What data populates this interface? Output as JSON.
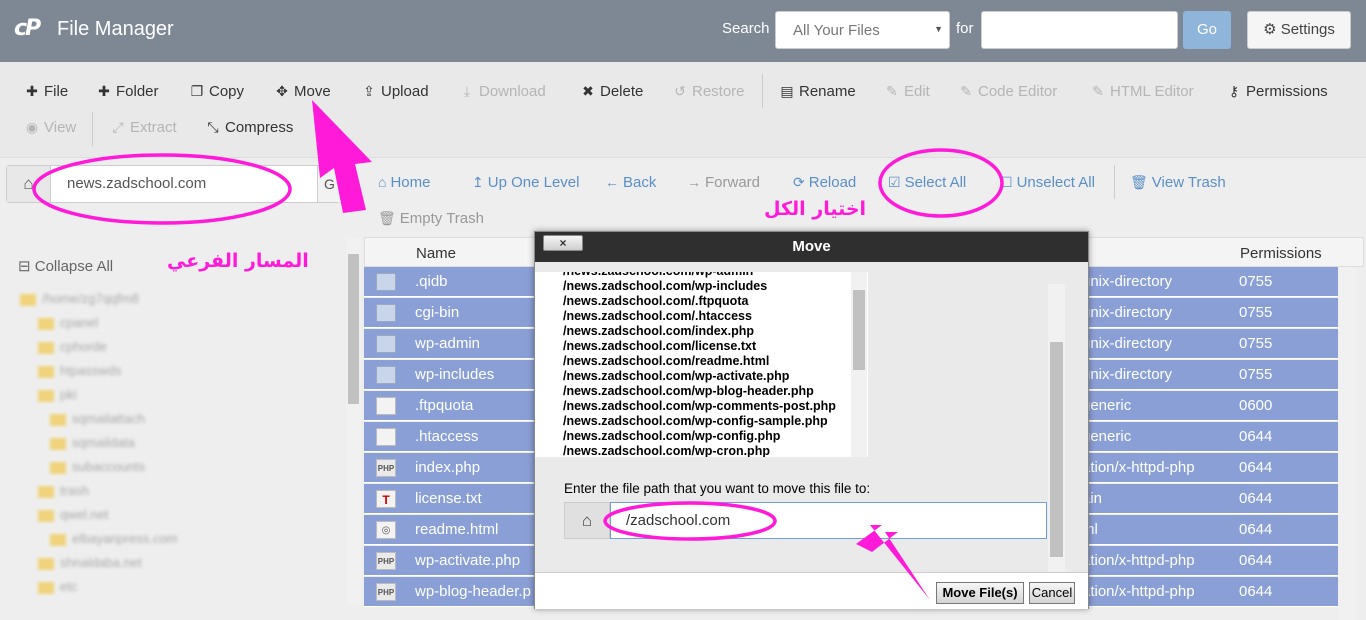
{
  "header": {
    "logo": "cP",
    "title": "File Manager",
    "search_label": "Search",
    "search_scope": "All Your Files",
    "for_label": "for",
    "search_value": "",
    "go_label": "Go",
    "settings_label": "Settings"
  },
  "toolbar": {
    "file": "File",
    "folder": "Folder",
    "copy": "Copy",
    "move": "Move",
    "upload": "Upload",
    "download": "Download",
    "delete": "Delete",
    "restore": "Restore",
    "rename": "Rename",
    "edit": "Edit",
    "code_editor": "Code Editor",
    "html_editor": "HTML Editor",
    "permissions": "Permissions",
    "view": "View",
    "extract": "Extract",
    "compress": "Compress"
  },
  "path": {
    "value": "news.zadschool.com",
    "go": "G"
  },
  "nav": {
    "home": "Home",
    "up": "Up One Level",
    "back": "Back",
    "forward": "Forward",
    "reload": "Reload",
    "select_all": "Select All",
    "unselect_all": "Unselect All",
    "view_trash": "View Trash",
    "empty_trash": "Empty Trash"
  },
  "sidebar": {
    "collapse": "Collapse All",
    "tree": [
      "/home/zg7qqfm8",
      "cpanel",
      "cphorde",
      "htpasswds",
      "pki",
      "sqmailattach",
      "sqmaildata",
      "subaccounts",
      "trash",
      "qwel.net",
      "elbayanpress.com",
      "shnaldaba.net",
      "etc"
    ]
  },
  "table": {
    "columns": {
      "name": "Name",
      "permissions": "Permissions"
    },
    "rows": [
      {
        "name": ".qidb",
        "type": "unix-directory",
        "perm": "0755",
        "icon": "folder"
      },
      {
        "name": "cgi-bin",
        "type": "unix-directory",
        "perm": "0755",
        "icon": "folder"
      },
      {
        "name": "wp-admin",
        "type": "unix-directory",
        "perm": "0755",
        "icon": "folder"
      },
      {
        "name": "wp-includes",
        "type": "unix-directory",
        "perm": "0755",
        "icon": "folder"
      },
      {
        "name": ".ftpquota",
        "type": "generic",
        "perm": "0600",
        "icon": "doc"
      },
      {
        "name": ".htaccess",
        "type": "generic",
        "perm": "0644",
        "icon": "doc"
      },
      {
        "name": "index.php",
        "type": "ation/x-httpd-php",
        "perm": "0644",
        "icon": "php"
      },
      {
        "name": "license.txt",
        "type": "ain",
        "perm": "0644",
        "icon": "txt"
      },
      {
        "name": "readme.html",
        "type": "ml",
        "perm": "0644",
        "icon": "html"
      },
      {
        "name": "wp-activate.php",
        "type": "ation/x-httpd-php",
        "perm": "0644",
        "icon": "php"
      },
      {
        "name": "wp-blog-header.p",
        "type": "ation/x-httpd-php",
        "perm": "0644",
        "icon": "php"
      }
    ]
  },
  "dialog": {
    "title": "Move",
    "close": "×",
    "files": [
      "/news.zadschool.com/wp-admin",
      "/news.zadschool.com/wp-includes",
      "/news.zadschool.com/.ftpquota",
      "/news.zadschool.com/.htaccess",
      "/news.zadschool.com/index.php",
      "/news.zadschool.com/license.txt",
      "/news.zadschool.com/readme.html",
      "/news.zadschool.com/wp-activate.php",
      "/news.zadschool.com/wp-blog-header.php",
      "/news.zadschool.com/wp-comments-post.php",
      "/news.zadschool.com/wp-config-sample.php",
      "/news.zadschool.com/wp-config.php",
      "/news.zadschool.com/wp-cron.php"
    ],
    "dest_label": "Enter the file path that you want to move this file to:",
    "dest_value": "/zadschool.com",
    "move_button": "Move File(s)",
    "cancel_button": "Cancel"
  },
  "annotations": {
    "subpath": "المسار الفرعي",
    "select_all": "اختيار الكل",
    "color": "#ff1ad9"
  }
}
